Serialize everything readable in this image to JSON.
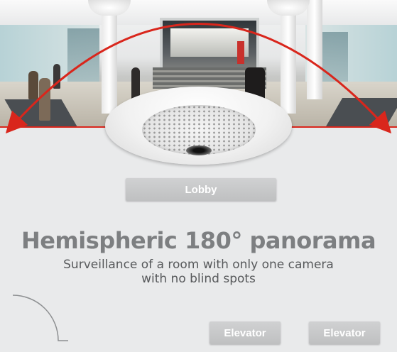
{
  "panorama": {
    "photo": "fisheye-lobby-photo",
    "arc_color": "#d9261c",
    "dome_camera": "hemispheric-dome-camera"
  },
  "diagram": {
    "room_label": "Lobby",
    "headline": "Hemispheric 180° panorama",
    "subline_1": "Surveillance of a room with only one camera",
    "subline_2": "with no blind spots",
    "elevators": [
      {
        "label": "Elevator"
      },
      {
        "label": "Elevator"
      }
    ],
    "label_color": "#c4c5c6",
    "headline_color": "#7d7f81"
  }
}
